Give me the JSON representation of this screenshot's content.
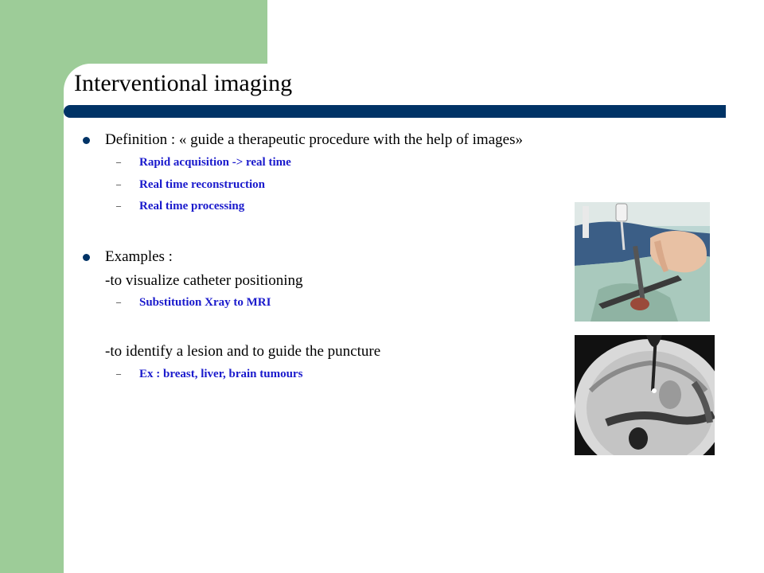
{
  "slide": {
    "title": "Interventional imaging",
    "bullets": [
      {
        "text": "Definition : « guide a therapeutic procedure with the help of images»",
        "sub": [
          "Rapid acquisition -> real time",
          "Real time reconstruction",
          "Real time processing"
        ]
      },
      {
        "text": "Examples :"
      }
    ],
    "examples": [
      {
        "text": "-to visualize catheter positioning",
        "sub": [
          "Substitution Xray to MRI"
        ]
      },
      {
        "text": "-to identify a lesion and to guide the puncture",
        "sub": [
          "Ex : breast, liver, brain tumours"
        ]
      }
    ],
    "dash_glyph": "–"
  },
  "colors": {
    "sidebar_green": "#9dcc98",
    "title_bar": "#003366",
    "bullet": "#003366",
    "subitem_text": "#1a1acc"
  },
  "images": [
    {
      "name": "surgery-photo"
    },
    {
      "name": "mri-scan"
    }
  ]
}
